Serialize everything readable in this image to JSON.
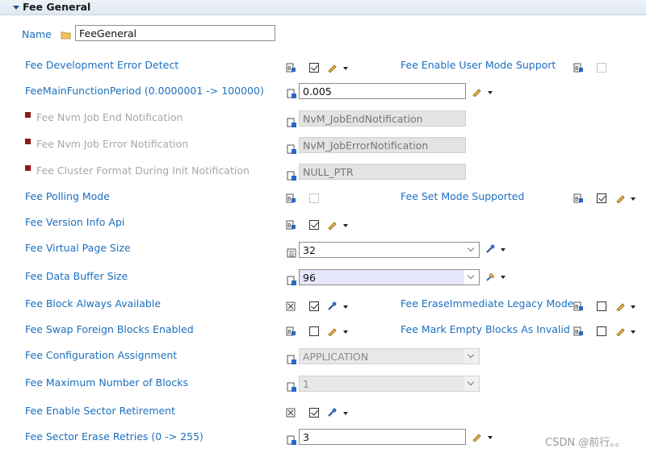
{
  "section": {
    "title": "Fee General"
  },
  "name": {
    "label": "Name",
    "value": "FeeGeneral"
  },
  "left_fields": {
    "dev_error_detect": "Fee Development Error Detect",
    "main_function_period": "FeeMainFunctionPeriod (0.0000001 -> 100000)",
    "nvm_job_end": "Fee Nvm Job End Notification",
    "nvm_job_error": "Fee Nvm Job Error Notification",
    "cluster_format": "Fee Cluster Format During Init Notification",
    "polling_mode": "Fee Polling Mode",
    "version_info_api": "Fee Version Info Api",
    "virtual_page_size": "Fee Virtual Page Size",
    "data_buffer_size": "Fee Data Buffer Size",
    "block_always_available": "Fee Block Always Available",
    "swap_foreign_blocks": "Fee Swap Foreign Blocks Enabled",
    "config_assignment": "Fee Configuration Assignment",
    "max_blocks": "Fee Maximum Number of Blocks",
    "sector_retirement": "Fee Enable Sector Retirement",
    "sector_erase_retries": "Fee Sector Erase Retries (0 -> 255)"
  },
  "right_fields": {
    "user_mode_support": "Fee Enable User Mode Support",
    "set_mode_supported": "Fee Set Mode Supported",
    "erase_immediate": "Fee EraseImmediate Legacy Mode",
    "mark_empty_blocks": "Fee Mark Empty Blocks As Invalid"
  },
  "values": {
    "main_function_period": "0.005",
    "nvm_job_end": "NvM_JobEndNotification",
    "nvm_job_error": "NvM_JobErrorNotification",
    "cluster_format": "NULL_PTR",
    "virtual_page_size": "32",
    "data_buffer_size": "96",
    "config_assignment": "APPLICATION",
    "max_blocks": "1",
    "sector_erase_retries": "3"
  },
  "checkboxes": {
    "dev_error_detect": true,
    "user_mode_support": false,
    "polling_mode": false,
    "set_mode_supported": true,
    "version_info_api": true,
    "block_always_available": true,
    "erase_immediate": false,
    "swap_foreign_blocks": false,
    "mark_empty_blocks": false,
    "sector_retirement": true
  },
  "watermark": "CSDN @前行。。",
  "colors": {
    "label": "#1d6fbf",
    "disabled_label": "#a8a8a8",
    "required_marker": "#8b1a1a",
    "selected_combo": "#e6e6fb"
  }
}
